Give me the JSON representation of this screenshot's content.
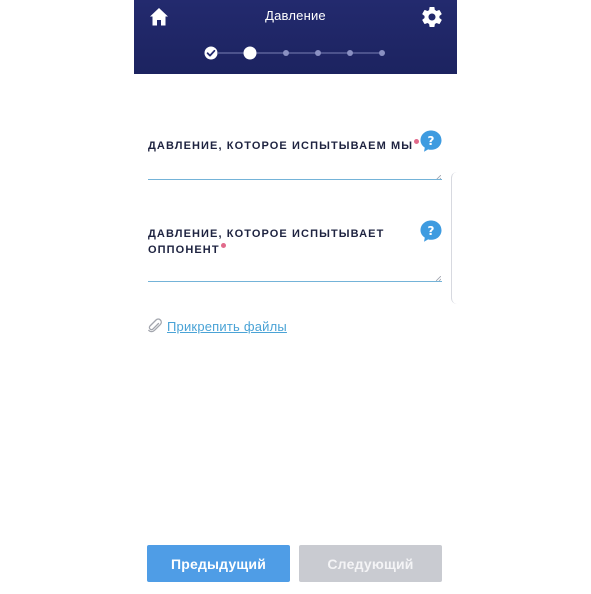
{
  "header": {
    "title": "Давление",
    "home_icon": "home-icon",
    "settings_icon": "gear-icon",
    "steps": {
      "total": 6,
      "current": 2,
      "completed": [
        1
      ]
    }
  },
  "form": {
    "fields": [
      {
        "label": "ДАВЛЕНИЕ, КОТОРОЕ ИСПЫТЫВАЕМ МЫ",
        "value": "",
        "required": true
      },
      {
        "label_line1": "ДАВЛЕНИЕ, КОТОРОЕ ИСПЫТЫВАЕТ",
        "label_line2": "ОППОНЕНТ",
        "value": "",
        "required": true
      }
    ],
    "attach_label": "Прикрепить файлы"
  },
  "footer": {
    "prev_label": "Предыдущий",
    "next_label": "Следующий",
    "next_enabled": false
  },
  "colors": {
    "header_bg": "#1f2766",
    "accent": "#4f9de6",
    "help_icon": "#3e9be0",
    "required_dot": "#e16a8b",
    "disabled": "#c9cbd1"
  }
}
